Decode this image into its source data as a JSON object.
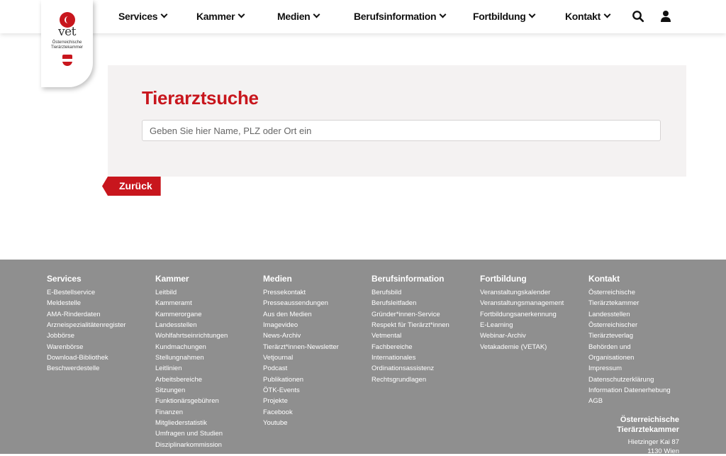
{
  "logo": {
    "word": "vet",
    "sub_line1": "Österreichische",
    "sub_line2": "Tierärztekammer"
  },
  "nav": {
    "items": [
      {
        "label": "Services"
      },
      {
        "label": "Kammer"
      },
      {
        "label": "Medien"
      },
      {
        "label": "Berufsinformation"
      },
      {
        "label": "Fortbildung"
      },
      {
        "label": "Kontakt"
      }
    ],
    "icons": [
      "search-icon",
      "user-icon"
    ]
  },
  "search": {
    "title": "Tierarztsuche",
    "placeholder": "Geben Sie hier Name, PLZ oder Ort ein",
    "value": ""
  },
  "back_label": "Zurück",
  "footer": {
    "columns": [
      {
        "heading": "Services",
        "links": [
          "E-Bestellservice",
          "Meldestelle",
          "AMA-Rinderdaten",
          "Arzneispezialitätenregister",
          "Jobbörse",
          "Warenbörse",
          "Download-Bibliothek",
          "Beschwerdestelle"
        ]
      },
      {
        "heading": "Kammer",
        "links": [
          "Leitbild",
          "Kammeramt",
          "Kammerorgane",
          "Landesstellen",
          "Wohlfahrtseinrichtungen",
          "Kundmachungen",
          "Stellungnahmen",
          "Leitlinien",
          "Arbeitsbereiche",
          "Sitzungen",
          "Funktionärsgebühren",
          "Finanzen",
          "Mitgliederstatistik",
          "Umfragen und Studien",
          "Disziplinarkommission"
        ]
      },
      {
        "heading": "Medien",
        "links": [
          "Pressekontakt",
          "Presseaussendungen",
          "Aus den Medien",
          "Imagevideo",
          "News-Archiv",
          "Tierärzt*innen-Newsletter",
          "Vetjournal",
          "Podcast",
          "Publikationen",
          "ÖTK-Events",
          "Projekte",
          "Facebook",
          "Youtube"
        ]
      },
      {
        "heading": "Berufsinformation",
        "links": [
          "Berufsbild",
          "Berufsleitfaden",
          "Gründer*innen-Service",
          "Respekt für Tierärzt*innen",
          "Vetmental",
          "Fachbereiche",
          "Internationales",
          "Ordinationsassistenz",
          "Rechtsgrundlagen"
        ]
      },
      {
        "heading": "Fortbildung",
        "links": [
          "Veranstaltungskalender",
          "Veranstaltungsmanagement",
          "Fortbildungsanerkennung",
          "E-Learning",
          "Webinar-Archiv",
          "Vetakademie (VETAK)"
        ]
      },
      {
        "heading": "Kontakt",
        "links": [
          "Österreichische",
          "Tierärztekammer",
          "Landesstellen",
          "Österreichischer",
          "Tierärzteverlag",
          "Behörden und",
          "Organisationen",
          "Impressum",
          "Datenschutzerklärung",
          "Information Datenerhebung",
          "AGB"
        ]
      }
    ],
    "address": {
      "org_line1": "Österreichische",
      "org_line2": "Tierärztekammer",
      "street": "Hietzinger Kai 87",
      "city": "1130 Wien"
    }
  }
}
